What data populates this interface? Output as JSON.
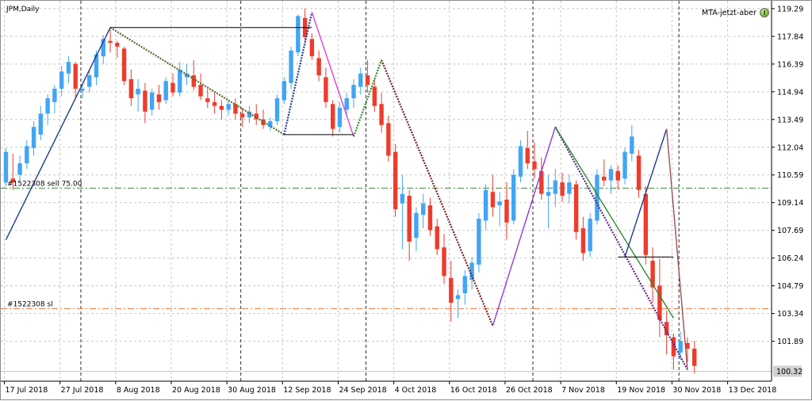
{
  "window": {
    "title": "JPM,Daily"
  },
  "expert_advisor": {
    "name": "MTA-jetzt-aber",
    "icon": "smiley-icon"
  },
  "colors": {
    "bull": "#42a5f5",
    "bear": "#ef3b2c",
    "background": "#ffffff",
    "grid": "#c7c7c7"
  },
  "chart_data": {
    "type": "candlestick",
    "symbol": "JPM",
    "timeframe": "Daily",
    "y_ticks": [
      "119.29",
      "117.84",
      "116.39",
      "114.94",
      "113.49",
      "112.04",
      "110.59",
      "109.14",
      "107.69",
      "106.24",
      "104.79",
      "103.34",
      "101.89"
    ],
    "ylim": [
      99.8,
      119.7
    ],
    "x_ticks": [
      {
        "label": "17 Jul 2018",
        "index": 0
      },
      {
        "label": "27 Jul 2018",
        "index": 8
      },
      {
        "label": "8 Aug 2018",
        "index": 16
      },
      {
        "label": "20 Aug 2018",
        "index": 24
      },
      {
        "label": "30 Aug 2018",
        "index": 32
      },
      {
        "label": "12 Sep 2018",
        "index": 40
      },
      {
        "label": "24 Sep 2018",
        "index": 48
      },
      {
        "label": "4 Oct 2018",
        "index": 56
      },
      {
        "label": "16 Oct 2018",
        "index": 64
      },
      {
        "label": "26 Oct 2018",
        "index": 72
      },
      {
        "label": "7 Nov 2018",
        "index": 80
      },
      {
        "label": "19 Nov 2018",
        "index": 88
      },
      {
        "label": "30 Nov 2018",
        "index": 96
      },
      {
        "label": "13 Dec 2018",
        "index": 104
      }
    ],
    "vertical_separators": [
      11,
      34,
      52,
      76,
      97
    ],
    "current_price": "100.32",
    "candles": [
      [
        110.2,
        112.0,
        110.0,
        111.8
      ],
      [
        110.4,
        111.7,
        109.8,
        110.2
      ],
      [
        110.6,
        111.6,
        110.3,
        111.2
      ],
      [
        111.2,
        112.4,
        110.9,
        112.1
      ],
      [
        112.0,
        113.4,
        111.6,
        113.1
      ],
      [
        112.7,
        114.2,
        112.4,
        113.8
      ],
      [
        113.8,
        114.8,
        113.2,
        114.6
      ],
      [
        114.4,
        115.3,
        113.8,
        115.1
      ],
      [
        115.1,
        116.3,
        114.7,
        116.0
      ],
      [
        115.9,
        116.8,
        115.4,
        116.5
      ],
      [
        116.4,
        116.5,
        114.6,
        115.1
      ],
      [
        115.0,
        115.3,
        114.6,
        115.1
      ],
      [
        115.2,
        116.1,
        114.9,
        115.8
      ],
      [
        115.7,
        117.1,
        115.3,
        116.9
      ],
      [
        116.8,
        117.9,
        116.4,
        117.7
      ],
      [
        117.6,
        118.2,
        117.0,
        117.5
      ],
      [
        117.5,
        117.6,
        116.7,
        117.3
      ],
      [
        117.2,
        117.3,
        115.3,
        115.5
      ],
      [
        115.6,
        116.1,
        114.2,
        114.6
      ],
      [
        114.8,
        115.6,
        113.9,
        115.1
      ],
      [
        115.0,
        115.4,
        113.3,
        113.9
      ],
      [
        114.0,
        115.1,
        113.7,
        114.9
      ],
      [
        114.8,
        115.3,
        114.0,
        114.4
      ],
      [
        114.5,
        115.7,
        114.3,
        115.5
      ],
      [
        115.4,
        115.9,
        114.7,
        114.9
      ],
      [
        114.9,
        116.5,
        114.7,
        116.1
      ],
      [
        115.7,
        116.4,
        115.3,
        115.9
      ],
      [
        115.8,
        116.6,
        115.0,
        115.2
      ],
      [
        115.3,
        115.9,
        114.5,
        114.7
      ],
      [
        114.6,
        115.1,
        114.1,
        114.4
      ],
      [
        114.4,
        114.9,
        113.8,
        114.2
      ],
      [
        114.2,
        114.5,
        113.5,
        114.0
      ],
      [
        114.0,
        114.5,
        113.7,
        114.3
      ],
      [
        114.3,
        114.6,
        113.5,
        113.8
      ],
      [
        113.8,
        114.1,
        113.1,
        113.6
      ],
      [
        113.6,
        114.2,
        113.3,
        113.9
      ],
      [
        113.8,
        114.3,
        113.2,
        113.5
      ],
      [
        113.5,
        114.0,
        113.0,
        113.2
      ],
      [
        113.1,
        113.6,
        112.9,
        113.4
      ],
      [
        113.4,
        114.8,
        113.2,
        114.6
      ],
      [
        114.5,
        115.7,
        114.3,
        115.5
      ],
      [
        115.4,
        117.3,
        115.1,
        117.1
      ],
      [
        117.0,
        119.0,
        116.8,
        118.9
      ],
      [
        118.8,
        119.3,
        117.6,
        117.8
      ],
      [
        117.7,
        118.0,
        116.6,
        116.8
      ],
      [
        116.7,
        117.1,
        115.5,
        115.8
      ],
      [
        115.7,
        116.2,
        114.1,
        114.4
      ],
      [
        114.3,
        114.5,
        112.6,
        113.0
      ],
      [
        113.1,
        114.4,
        112.8,
        114.1
      ],
      [
        114.0,
        114.9,
        113.7,
        114.6
      ],
      [
        114.6,
        115.6,
        114.1,
        115.3
      ],
      [
        115.2,
        116.2,
        114.8,
        115.9
      ],
      [
        115.8,
        116.6,
        114.9,
        115.3
      ],
      [
        115.2,
        115.6,
        113.9,
        114.2
      ],
      [
        114.3,
        114.9,
        112.8,
        113.2
      ],
      [
        113.3,
        113.7,
        111.3,
        111.6
      ],
      [
        111.8,
        112.2,
        108.4,
        108.8
      ],
      [
        109.1,
        110.6,
        106.7,
        109.6
      ],
      [
        109.5,
        109.8,
        106.1,
        107.1
      ],
      [
        107.3,
        108.9,
        106.6,
        108.6
      ],
      [
        108.5,
        109.6,
        107.8,
        109.1
      ],
      [
        109.0,
        109.4,
        107.4,
        107.7
      ],
      [
        107.9,
        108.3,
        106.4,
        106.7
      ],
      [
        106.8,
        107.5,
        104.9,
        105.3
      ],
      [
        105.2,
        106.1,
        102.9,
        103.9
      ],
      [
        104.1,
        104.6,
        103.1,
        104.3
      ],
      [
        104.4,
        105.6,
        103.8,
        105.3
      ],
      [
        105.1,
        106.3,
        104.6,
        106.0
      ],
      [
        105.9,
        108.6,
        105.5,
        108.3
      ],
      [
        108.2,
        110.1,
        107.7,
        109.8
      ],
      [
        109.7,
        110.6,
        108.4,
        108.9
      ],
      [
        109.0,
        109.7,
        107.9,
        109.2
      ],
      [
        109.3,
        110.2,
        107.2,
        108.1
      ],
      [
        108.2,
        110.9,
        108.0,
        110.6
      ],
      [
        110.5,
        112.4,
        110.2,
        112.1
      ],
      [
        112.0,
        112.9,
        110.9,
        111.2
      ],
      [
        111.3,
        112.3,
        110.4,
        110.9
      ],
      [
        110.8,
        111.5,
        109.3,
        109.6
      ],
      [
        109.5,
        110.6,
        107.8,
        109.7
      ],
      [
        109.6,
        110.9,
        108.9,
        110.3
      ],
      [
        110.2,
        110.7,
        109.2,
        109.5
      ],
      [
        109.6,
        110.6,
        109.1,
        110.2
      ],
      [
        110.1,
        110.3,
        107.2,
        107.6
      ],
      [
        107.8,
        108.4,
        106.1,
        106.5
      ],
      [
        106.6,
        108.6,
        106.3,
        108.3
      ],
      [
        108.2,
        110.9,
        108.0,
        110.6
      ],
      [
        110.5,
        111.4,
        110.0,
        110.3
      ],
      [
        110.3,
        111.1,
        109.6,
        110.9
      ],
      [
        110.8,
        111.1,
        109.8,
        110.3
      ],
      [
        110.4,
        112.0,
        110.1,
        111.8
      ],
      [
        111.7,
        113.2,
        111.3,
        112.6
      ],
      [
        111.6,
        111.9,
        109.4,
        109.8
      ],
      [
        109.6,
        110.0,
        105.9,
        106.4
      ],
      [
        106.1,
        106.8,
        103.9,
        104.7
      ],
      [
        104.8,
        106.2,
        102.1,
        103.0
      ],
      [
        102.9,
        103.5,
        101.2,
        102.2
      ],
      [
        102.1,
        102.3,
        100.4,
        101.1
      ],
      [
        101.3,
        102.4,
        100.9,
        101.9
      ],
      [
        101.8,
        102.1,
        100.8,
        101.5
      ],
      [
        101.5,
        101.9,
        100.2,
        100.6
      ]
    ],
    "zigzag_segments": [
      {
        "from": [
          0,
          107.2
        ],
        "to": [
          15,
          118.3
        ],
        "color": "#1f3a93",
        "style": "solid"
      },
      {
        "from": [
          15,
          118.3
        ],
        "to": [
          40,
          112.7
        ],
        "color": "#556b2f",
        "style": "dashed"
      },
      {
        "from": [
          40,
          112.7
        ],
        "to": [
          44,
          119.1
        ],
        "color": "#1f3a93",
        "style": "dashed"
      },
      {
        "from": [
          44,
          119.1
        ],
        "to": [
          50,
          112.6
        ],
        "color": "#e040d8",
        "style": "solid"
      },
      {
        "from": [
          50,
          112.6
        ],
        "to": [
          54,
          116.6
        ],
        "color": "#2e8b2e",
        "style": "dashed"
      },
      {
        "from": [
          54,
          116.6
        ],
        "to": [
          70,
          102.7
        ],
        "color": "#7b1f1f",
        "style": "dashed"
      },
      {
        "from": [
          70,
          102.7
        ],
        "to": [
          79,
          113.1
        ],
        "color": "#8e3bd6",
        "style": "solid"
      },
      {
        "from": [
          79,
          113.1
        ],
        "to": [
          98,
          100.4
        ],
        "color": "#5b2a86",
        "style": "dashed"
      },
      {
        "from": [
          79,
          113.1
        ],
        "to": [
          96,
          103.1
        ],
        "color": "#2e8b2e",
        "style": "solid"
      },
      {
        "from": [
          89,
          106.3
        ],
        "to": [
          95,
          113.0
        ],
        "color": "#1f3a93",
        "style": "solid"
      },
      {
        "from": [
          95,
          113.0
        ],
        "to": [
          98,
          100.4
        ],
        "color": "#a05050",
        "style": "solid"
      }
    ],
    "horizontal_segments": [
      {
        "from": [
          15,
          118.3
        ],
        "to": [
          44,
          118.3
        ],
        "color": "#000000"
      },
      {
        "from": [
          40,
          112.7
        ],
        "to": [
          50,
          112.7
        ],
        "color": "#000000"
      },
      {
        "from": [
          88,
          106.3
        ],
        "to": [
          96,
          106.3
        ],
        "color": "#000000"
      }
    ],
    "annotations": [
      {
        "text": "#1522308 sell 75.00",
        "price": 109.9,
        "color": "#3c8c3c"
      },
      {
        "text": "#1522308 sl",
        "price": 103.6,
        "color": "#f07838"
      }
    ]
  }
}
